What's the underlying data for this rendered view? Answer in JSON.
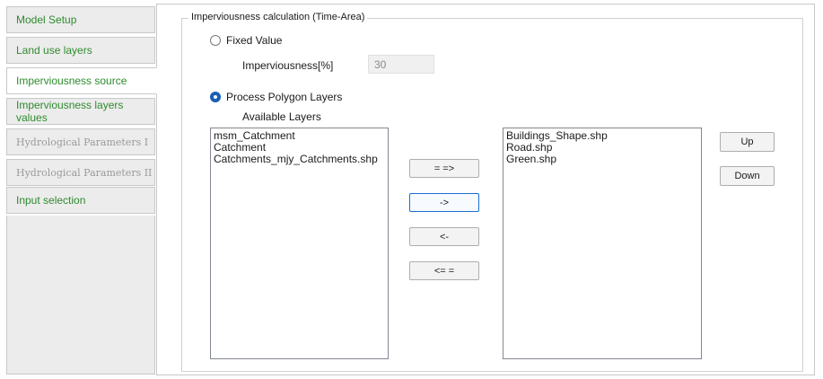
{
  "tabs": [
    {
      "label": "Model Setup",
      "state": "normal"
    },
    {
      "label": "Land use layers",
      "state": "normal"
    },
    {
      "label": "Imperviousness source",
      "state": "active"
    },
    {
      "label": "Imperviousness layers values",
      "state": "normal"
    },
    {
      "label": "Hydrological Parameters I",
      "state": "disabled"
    },
    {
      "label": "Hydrological Parameters II",
      "state": "disabled"
    },
    {
      "label": "Input selection",
      "state": "normal"
    }
  ],
  "group": {
    "title": "Imperviousness calculation (Time-Area)"
  },
  "fixed_value": {
    "label": "Fixed Value",
    "selected": false,
    "imperviousness_label": "Imperviousness[%]",
    "imperviousness_value": "30"
  },
  "process_polygon": {
    "label": "Process Polygon Layers",
    "selected": true,
    "available_label": "Available Layers"
  },
  "available_layers": [
    "msm_Catchment",
    "Catchment",
    "Catchments_mjy_Catchments.shp"
  ],
  "selected_layers": [
    "Buildings_Shape.shp",
    "Road.shp",
    "Green.shp"
  ],
  "buttons": {
    "add_all": "= =>",
    "add": "->",
    "remove": "<-",
    "remove_all": "<= =",
    "up": "Up",
    "down": "Down"
  },
  "colors": {
    "tab_text": "#2e8b2e",
    "tab_disabled_text": "#9a9a9a",
    "radio_selected": "#1a5fb4",
    "focus_border": "#1a6fd0"
  }
}
